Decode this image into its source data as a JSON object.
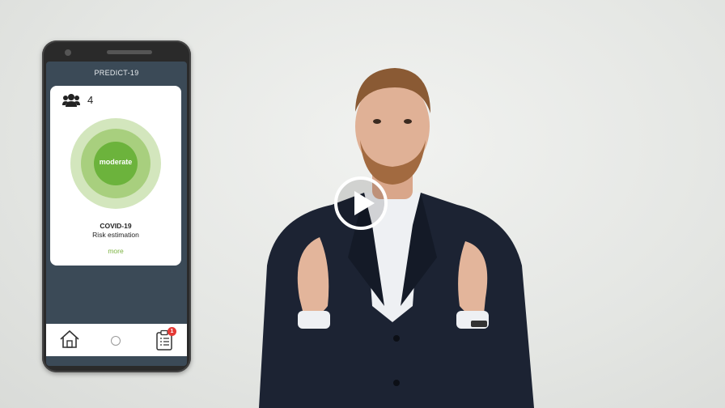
{
  "app": {
    "title": "PREDICT-19",
    "group_count": "4",
    "risk_level": "moderate",
    "card_title": "COVID-19",
    "card_subtitle": "Risk estimation",
    "more_label": "more",
    "notification_count": "1"
  },
  "icons": {
    "people": "people-group-icon",
    "home": "home-icon",
    "center": "circle-icon",
    "clipboard": "clipboard-list-icon",
    "play": "play-icon"
  },
  "colors": {
    "app_background": "#3b4a57",
    "risk_outer": "#d3e6bd",
    "risk_mid": "#a8cf7e",
    "risk_inner": "#6cb33c",
    "more_link": "#7cb342",
    "badge": "#e53935"
  }
}
